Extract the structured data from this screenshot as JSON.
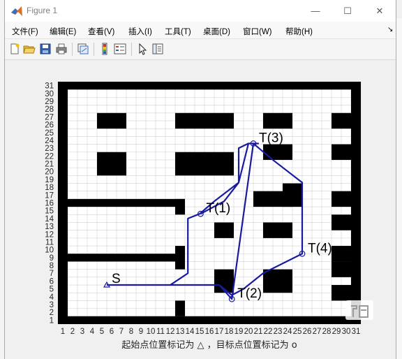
{
  "window": {
    "title": "Figure 1",
    "controls": {
      "minimize": "—",
      "maximize": "☐",
      "close": "✕"
    }
  },
  "menu": [
    "文件(F)",
    "编辑(E)",
    "查看(V)",
    "插入(I)",
    "工具(T)",
    "桌面(D)",
    "窗口(W)",
    "帮助(H)"
  ],
  "menu_overflow": "↘",
  "toolbar": [
    "new-figure-icon",
    "open-file-icon",
    "save-icon",
    "print-icon",
    "link-plot-icon",
    "colorbar-icon",
    "legend-icon",
    "pointer-icon",
    "property-inspector-icon"
  ],
  "chart_data": {
    "type": "line",
    "xlim": [
      1,
      31
    ],
    "ylim": [
      1,
      31
    ],
    "x_ticks": [
      1,
      2,
      3,
      4,
      5,
      6,
      7,
      8,
      9,
      10,
      11,
      12,
      13,
      14,
      15,
      16,
      17,
      18,
      19,
      20,
      21,
      22,
      23,
      24,
      25,
      26,
      27,
      28,
      29,
      30,
      31
    ],
    "y_ticks": [
      1,
      2,
      3,
      4,
      5,
      6,
      7,
      8,
      9,
      10,
      11,
      12,
      13,
      14,
      15,
      16,
      17,
      18,
      19,
      20,
      21,
      22,
      23,
      24,
      25,
      26,
      27,
      28,
      29,
      30,
      31
    ],
    "grid": true,
    "xlabel": "起始点位置标记为 △ ，目标点位置标记为 o",
    "path_color": "#1a1aa0",
    "obstacle_color": "#000000",
    "obstacles": [
      [
        1,
        1,
        1,
        31
      ],
      [
        31,
        31,
        1,
        31
      ],
      [
        1,
        31,
        1,
        1
      ],
      [
        1,
        31,
        31,
        31
      ],
      [
        5,
        7,
        26,
        27
      ],
      [
        13,
        18,
        26,
        27
      ],
      [
        22,
        24,
        26,
        27
      ],
      [
        29,
        30,
        26,
        27
      ],
      [
        5,
        7,
        20,
        22
      ],
      [
        13,
        18,
        20,
        22
      ],
      [
        22,
        24,
        22,
        23
      ],
      [
        29,
        30,
        22,
        23
      ],
      [
        2,
        13,
        16,
        16
      ],
      [
        13,
        13,
        15,
        16
      ],
      [
        21,
        24,
        16,
        17
      ],
      [
        24,
        25,
        16,
        18
      ],
      [
        29,
        30,
        16,
        17
      ],
      [
        29,
        30,
        13,
        14
      ],
      [
        17,
        18,
        12,
        13
      ],
      [
        22,
        24,
        12,
        13
      ],
      [
        2,
        13,
        9,
        9
      ],
      [
        13,
        13,
        8,
        10
      ],
      [
        29,
        30,
        9,
        10
      ],
      [
        29,
        30,
        7,
        8
      ],
      [
        17,
        18,
        5,
        7
      ],
      [
        22,
        24,
        5,
        7
      ],
      [
        29,
        30,
        4,
        5
      ],
      [
        13,
        13,
        2,
        3
      ]
    ],
    "series": [
      {
        "x": [
          5.5,
          12,
          17,
          18.3,
          19.5,
          21.5,
          25.5,
          25.5,
          22.5,
          20.5,
          18.3,
          17,
          12,
          13.8,
          13.8,
          15,
          16.5,
          19,
          19,
          20,
          21,
          21,
          20,
          19,
          17.5,
          15.1
        ],
        "y": [
          5.5,
          5.5,
          5.5,
          4.2,
          5,
          7,
          9.5,
          18.6,
          21.5,
          23.6,
          3.7,
          5.5,
          5.5,
          7,
          14,
          14.6,
          16.2,
          18.6,
          23,
          23.6,
          23.6,
          23.6,
          23.6,
          18.6,
          16.2,
          14.6
        ]
      }
    ],
    "start": {
      "label": "S",
      "x": 5.5,
      "y": 5.5
    },
    "targets": [
      {
        "label": "T(1)",
        "x": 15.1,
        "y": 14.6
      },
      {
        "label": "T(2)",
        "x": 18.3,
        "y": 3.7
      },
      {
        "label": "T(3)",
        "x": 20.5,
        "y": 23.6
      },
      {
        "label": "T(4)",
        "x": 25.5,
        "y": 9.5
      }
    ]
  }
}
